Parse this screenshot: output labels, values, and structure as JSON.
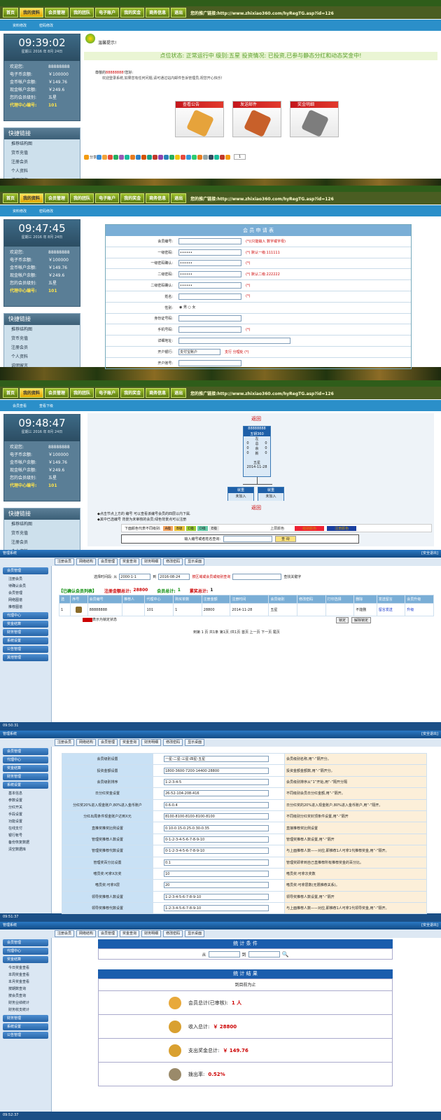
{
  "nav": {
    "items": [
      "首页",
      "我的资料",
      "会员管理",
      "我的团队",
      "电子账户",
      "我的奖金",
      "商务信息",
      "退出"
    ],
    "promo": "您的推广链接:http://www.zhixiao360.com/hyRegTG.asp?id=126"
  },
  "subnav": {
    "a": [
      "资料修改",
      "密码修改"
    ],
    "c": [
      "会员查看",
      "查看下级"
    ]
  },
  "panel": {
    "labels": [
      "欢迎您:",
      "电子币余额:",
      "金币帐户余额:",
      "现金帐户余额:",
      "您的会员级别:",
      "代理中心编号:"
    ],
    "values": [
      "88888888",
      "￥100000",
      "￥149.76",
      "￥249.6",
      "五星",
      "101"
    ],
    "date": "星期三 2016 年 8月 24日"
  },
  "clocks": [
    "09:39:02",
    "09:47:45",
    "09:48:47"
  ],
  "quick": {
    "title": "快捷链接",
    "items": [
      "推荐结构图",
      "货币充值",
      "注册会员",
      "个人资料",
      "说明留言"
    ]
  },
  "s1": {
    "tip": "温馨提示!",
    "status": "点位状态:   正常运行中   级别:五星   投资情况:   已投资,已参与静态分红和动态奖金中!",
    "greet_pre": "尊敬的",
    "greet_user": "88888888",
    "greet_suf": "!您好:",
    "welcome": "欢迎登录系统,如果您有任何问题,请可通过站内邮件告诉管理员,祝您开心快乐!",
    "tiles": [
      "查看公告",
      "发送邮件",
      "奖金明细"
    ],
    "share": "分享",
    "count": "1"
  },
  "s2": {
    "title": "会 员 申 请 表",
    "rows": [
      {
        "label": "会员编号:",
        "value": "",
        "hint": "(*)(只能输入 数字或字母)"
      },
      {
        "label": "一级密码:",
        "value": "••••••",
        "hint": "(*) 默认一级:111111"
      },
      {
        "label": "一级密码确认:",
        "value": "••••••",
        "hint": "(*)"
      },
      {
        "label": "二级密码:",
        "value": "••••••",
        "hint": "(*) 默认二级:222222"
      },
      {
        "label": "二级密码确认:",
        "value": "••••••",
        "hint": "(*)"
      },
      {
        "label": "姓名:",
        "value": "",
        "hint": "(*)"
      },
      {
        "label": "性别:",
        "value": "◉ 男 ○ 女",
        "hint": ""
      },
      {
        "label": "身份证号码:",
        "value": "",
        "hint": ""
      },
      {
        "label": "手机号码:",
        "value": "",
        "hint": "(*)"
      },
      {
        "label": "详细地址:",
        "value": "",
        "hint": ""
      },
      {
        "label": "开户银行:",
        "value": "支付宝账户",
        "hint": "支行              分理处  (*)"
      },
      {
        "label": "开户账号:",
        "value": "",
        "hint": ""
      }
    ]
  },
  "s3": {
    "back": "返回",
    "node": {
      "id": "88888888",
      "name": "五钥360",
      "l1": [
        "左",
        "右"
      ],
      "l2": [
        "0",
        "总",
        "0"
      ],
      "l3": [
        "0",
        "余",
        "0"
      ],
      "l4": [
        "0",
        "新",
        "0"
      ],
      "level": "五星",
      "date": "2014-11-28"
    },
    "child": [
      "就重",
      "未加入"
    ],
    "note1": "◆点击节点上方的 编号 可以查看该编号会员的四层以内下属.",
    "note2": "◆其中已选编号 背景为未审核的会员;绿色背景点可以注册",
    "legend": "下面颜色代表不同级别:",
    "levels": [
      "A级",
      "B级",
      "C级",
      "D级",
      "E级"
    ],
    "lcolors": [
      "#f4a460",
      "#e8c23a",
      "#9acd32",
      "#66cdaa",
      "#e6e6e6"
    ],
    "colorlab": [
      "上层颜色",
      "级别颜色",
      "注册颜色"
    ],
    "search": "输入编号或者姓名查询:",
    "qbtn": "查 询"
  },
  "admin": {
    "title": "管理系统",
    "safe": "[安全退出]",
    "tools": [
      "注册会员",
      "网络结构",
      "会员管理",
      "奖金查询",
      "财务明细",
      "修改密码",
      "显示桌面"
    ],
    "times": [
      "09:50:31",
      "09:51:37",
      "09:52:37"
    ]
  },
  "s4": {
    "side": [
      "会员管理",
      "注册会员",
      "待确认会员",
      "会员管理",
      "网络图谱",
      "推荐图谱",
      "代理中心",
      "奖金结算",
      "财务管理",
      "系统设置",
      "公告管理",
      "其他管理"
    ],
    "filter": "选择时间段: 从",
    "d1": "2000-1-1",
    "to": "到",
    "d2": "2016-08-24",
    "area": "按区域或会员或级别查询",
    "kw": "查找关键字",
    "listtitle": "【已确认会员列表】",
    "amt_lab": "注册金额总计:",
    "amt": "28800",
    "cnt_lab": "会员总计:",
    "cnt": "1",
    "bonus_lab": "累奖总计:",
    "bonus": "1",
    "cols": [
      "选",
      "序号",
      "会员编号",
      "推荐人",
      "代理中心",
      "购买单数",
      "注册金额",
      "注册时间",
      "会员级别",
      "修改密码",
      "打印选择",
      "删除",
      "发送留言",
      "会员升级"
    ],
    "row": [
      "1",
      "88888888",
      "",
      "101",
      "1",
      "28800",
      "2014-11-28",
      "五星",
      "",
      "",
      "不能删",
      "留言发送",
      "升级"
    ],
    "locked": "表示为锁定状态",
    "b1": "锁定",
    "b2": "解除锁定",
    "pager": "到第 1 页 共1条 第1页 /共1页 首页 上一页 下一页 尾页"
  },
  "s5": {
    "side": [
      "会员管理",
      "代理中心",
      "奖金结算",
      "财务管理",
      "系统设置",
      "基本信息",
      "参数设置",
      "分红开关",
      "手段设置",
      "功能设置",
      "在线支付",
      "银行帐号",
      "备份恢复数据",
      "清空数据库"
    ],
    "rows": [
      [
        "会员级别设置",
        "一星-二星-三星-四星-五星",
        "会员级别名称,用“-”隔开分。"
      ],
      [
        "投资金额设置",
        "1800-3600-7200-14400-28800",
        "投资金额金额数,用“-”隔开分。"
      ],
      [
        "会员级别排序",
        "1-2-3-4-5",
        "会员级别排序从“1”开始,用“-”隔开分隔"
      ],
      [
        "日分红奖金设置",
        "26-52-104-208-416",
        "不同级别会员日分红金额,用“-”隔开。"
      ],
      [
        "分红奖20%进入现金账户,80%进入金币账户",
        "0.6-0.4",
        "日分红奖的20%进入现金账户,80%进入金币账户,用“-”隔开。"
      ],
      [
        "分红出局条件现金账户达到X元",
        "8100-8100-8100-8100-8100",
        "不同级别分红奖封顶条件设置,用“-”隔开"
      ],
      [
        "直推奖推奖比例设置",
        "0.10-0.15-0.25-0.30-0.35",
        "直接推荐奖比例设置"
      ],
      [
        "管理奖推荐人数设置",
        "0-1-2-3-4-5-6-7-8-9-10",
        "管理奖推荐人数设置,用“-”隔开"
      ],
      [
        "管理奖推荐代数设置",
        "0-1-2-3-4-5-6-7-8-9-10",
        "与上面推荐人数——对应,即推荐1人可拿1代推荐奖金,用“-”隔开。"
      ],
      [
        "管理奖百分比设置",
        "0.1",
        "管理奖即拿到自己直推荐所有推荐奖金的百分比。"
      ],
      [
        "嗜员奖:可拿X次奖",
        "10",
        "嗜员奖:可拿次奖数"
      ],
      [
        "嗜员奖:可拿X层",
        "20",
        "嗜员奖:可拿层数(无限推荐关系)。"
      ],
      [
        "领导奖推荐人数设置",
        "1-2-3-4-5-6-7-8-9-10",
        "领导奖推荐人数设置,用“-”隔开"
      ],
      [
        "领导奖推荐代数设置",
        "1-2-3-4-5-6-7-8-9-10",
        "与上面推荐人数——对应,即推荐1人可拿1代领导奖金,用“-”隔开。"
      ]
    ]
  },
  "s6": {
    "side": [
      "会员管理",
      "代理中心",
      "奖金结算",
      "今日奖金查看",
      "本周奖金查看",
      "本月奖金查看",
      "按期数查询",
      "按会员查询",
      "财务业绩统计",
      "财务收支统计",
      "财务管理",
      "系统设置",
      "公告管理"
    ],
    "cond": "统 计 条 件",
    "from": "从",
    "to": "到",
    "result": "统 计 结 果",
    "now": "到目前为止",
    "stats": [
      {
        "lab": "会员总计(已审核):",
        "val": "1 人",
        "c": "#c00"
      },
      {
        "lab": "收入总计:",
        "val": "￥ 28800",
        "c": "#c00"
      },
      {
        "lab": "支出奖金总计:",
        "val": "￥ 149.76",
        "c": "#c00"
      },
      {
        "lab": "拨出率:",
        "val": "0.52%",
        "c": "#c00"
      }
    ]
  },
  "colors": {
    "topnav": "#4a5d22",
    "subnav": "#2b8fc9",
    "admin": "#1b5c9c"
  }
}
